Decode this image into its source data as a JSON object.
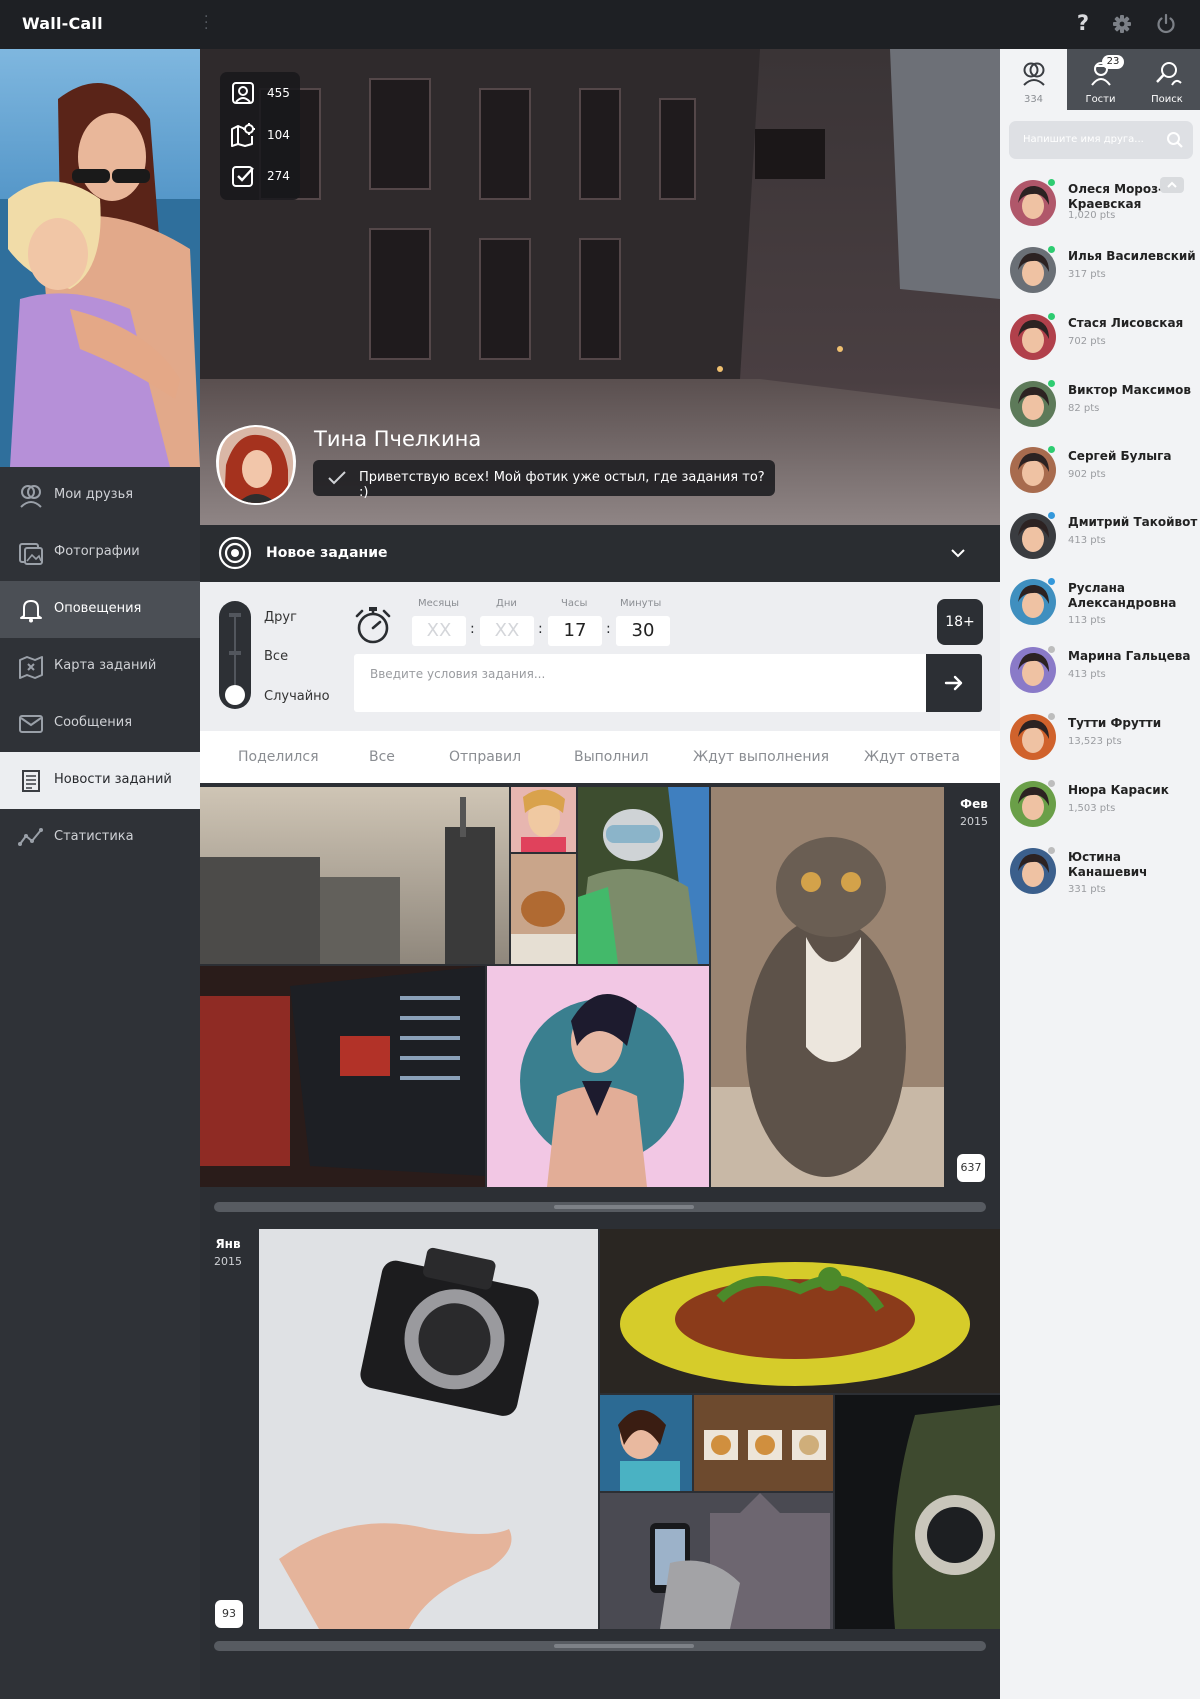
{
  "app": {
    "title": "Wall-Call"
  },
  "colors": {
    "topbar": "#1e2024",
    "sidebar": "#2f3237",
    "sidebar_active": "#4b4f55",
    "accent": "#2c2f34",
    "online": "#2ecc71",
    "away": "#3498db",
    "offline": "#bdbdbd"
  },
  "topbar_icons": [
    "help-icon",
    "gear-icon",
    "power-icon"
  ],
  "topbar": {
    "help": "?"
  },
  "sidebar": {
    "items": [
      {
        "label": "Мои друзья",
        "icon": "friends-icon"
      },
      {
        "label": "Фотографии",
        "icon": "photos-icon"
      },
      {
        "label": "Оповещения",
        "icon": "bell-icon"
      },
      {
        "label": "Карта заданий",
        "icon": "task-map-icon"
      },
      {
        "label": "Сообщения",
        "icon": "messages-icon"
      },
      {
        "label": "Новости заданий",
        "icon": "news-icon"
      },
      {
        "label": "Статистика",
        "icon": "stats-icon"
      }
    ]
  },
  "profile": {
    "name": "Тина Пчелкина",
    "status": "Приветствую всех! Мой фотик уже остыл, где задания то? :)",
    "stats": [
      {
        "icon": "photo-frame-icon",
        "value": "455"
      },
      {
        "icon": "map-target-icon",
        "value": "104"
      },
      {
        "icon": "check-square-icon",
        "value": "274"
      }
    ]
  },
  "task": {
    "title": "Новое задание",
    "recipients": [
      "Друг",
      "Все",
      "Случайно"
    ],
    "timer": {
      "labels": [
        "Месяцы",
        "Дни",
        "Часы",
        "Минуты"
      ],
      "placeholder": "XX",
      "hours": "17",
      "minutes": "30"
    },
    "age": "18+",
    "input_placeholder": "Введите условия задания..."
  },
  "feed_tabs": [
    "Поделился",
    "Все",
    "Отправил",
    "Выполнил",
    "Ждут выполнения",
    "Ждут ответа"
  ],
  "feed": [
    {
      "month": "Фев",
      "year": "2015",
      "count": "637"
    },
    {
      "month": "Янв",
      "year": "2015",
      "count": "93"
    }
  ],
  "right_tabs": [
    {
      "label": "334",
      "icon": "friends-icon"
    },
    {
      "label": "Гости",
      "icon": "guests-icon",
      "badge": "23"
    },
    {
      "label": "Поиск",
      "icon": "search-people-icon"
    }
  ],
  "friend_search": {
    "placeholder": "Напишите имя друга..."
  },
  "friends": [
    {
      "name": "Олеся Мороз-Краевская",
      "pts": "1,020 pts",
      "status": "online"
    },
    {
      "name": "Илья Василевский",
      "pts": "317 pts",
      "status": "online"
    },
    {
      "name": "Стася Лисовская",
      "pts": "702 pts",
      "status": "online"
    },
    {
      "name": "Виктор Максимов",
      "pts": "82 pts",
      "status": "online"
    },
    {
      "name": "Сергей Булыга",
      "pts": "902 pts",
      "status": "online"
    },
    {
      "name": "Дмитрий Такойвот",
      "pts": "413 pts",
      "status": "away"
    },
    {
      "name": "Руслана Александровна",
      "pts": "113 pts",
      "status": "away"
    },
    {
      "name": "Марина Гальцева",
      "pts": "413 pts",
      "status": "offline"
    },
    {
      "name": "Тутти Фрутти",
      "pts": "13,523 pts",
      "status": "offline"
    },
    {
      "name": "Нюра Карасик",
      "pts": "1,503 pts",
      "status": "offline"
    },
    {
      "name": "Юстина Канашевич",
      "pts": "331 pts",
      "status": "offline"
    }
  ]
}
